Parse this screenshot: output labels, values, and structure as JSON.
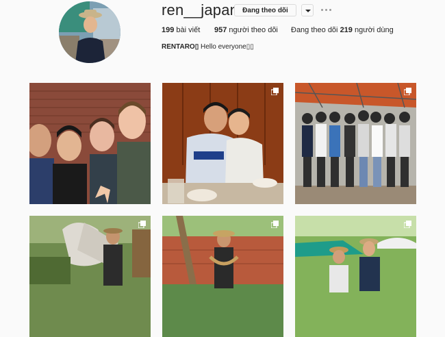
{
  "profile": {
    "username": "ren__japan",
    "follow_button": "Đang theo dõi",
    "dropdown_icon": "caret-down-icon",
    "more_icon": "more-options-icon",
    "stats": {
      "posts_count": "199",
      "posts_label": "bài viết",
      "followers_count": "957",
      "followers_label": "người theo dõi",
      "following_prefix": "Đang theo dõi",
      "following_count": "219",
      "following_suffix": "người dùng"
    },
    "bio_name": "RENTARO▯",
    "bio_text": "Hello everyone▯▯"
  },
  "posts": [
    {
      "index": 1,
      "multi": false
    },
    {
      "index": 2,
      "multi": true
    },
    {
      "index": 3,
      "multi": true
    },
    {
      "index": 4,
      "multi": true
    },
    {
      "index": 5,
      "multi": true
    },
    {
      "index": 6,
      "multi": true
    }
  ],
  "colors": {
    "background": "#fafafa",
    "border": "#dbdbdb",
    "text": "#262626"
  }
}
